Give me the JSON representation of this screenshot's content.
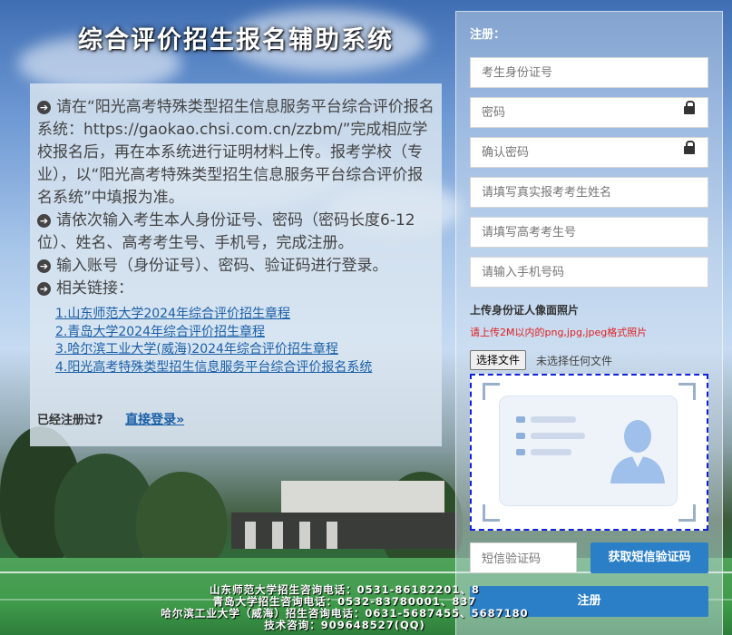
{
  "site": {
    "title": "综合评价招生报名辅助系统"
  },
  "info": {
    "items": [
      "请在“阳光高考特殊类型招生信息服务平台综合评价报名系统：https://gaokao.chsi.com.cn/zzbm/”完成相应学校报名后，再在本系统进行证明材料上传。报考学校（专业），以“阳光高考特殊类型招生信息服务平台综合评价报名系统”中填报为准。",
      "请依次输入考生本人身份证号、密码（密码长度6-12位）、姓名、高考考生号、手机号，完成注册。",
      "输入账号（身份证号）、密码、验证码进行登录。",
      "相关链接："
    ],
    "links": [
      "1.山东师范大学2024年综合评价招生章程",
      "2.青岛大学2024年综合评价招生章程",
      "3.哈尔滨工业大学(威海)2024年综合评价招生章程",
      "4.阳光高考特殊类型招生信息服务平台综合评价报名系统"
    ],
    "registered_prompt": "已经注册过?",
    "login_link": "直接登录»"
  },
  "register": {
    "heading": "注册：",
    "id_placeholder": "考生身份证号",
    "password_placeholder": "密码",
    "confirm_placeholder": "确认密码",
    "name_placeholder": "请填写真实报考考生姓名",
    "exam_no_placeholder": "请填写高考考生号",
    "phone_placeholder": "请输入手机号码",
    "upload_title": "上传身份证人像面照片",
    "upload_hint": "请上传2M以内的png,jpg,jpeg格式照片",
    "file_button": "选择文件",
    "file_status": "未选择任何文件",
    "sms_placeholder": "短信验证码",
    "sms_button": "获取短信验证码",
    "submit_button": "注册"
  },
  "footer": {
    "lines": [
      "山东师范大学招生咨询电话：0531-86182201、8",
      "青岛大学招生咨询电话：0532-83780001、837",
      "哈尔滨工业大学（威海）招生咨询电话：0631-5687455、5687180",
      "技术咨询：909648527(QQ)"
    ]
  },
  "colors": {
    "accent": "#2b7fc7",
    "link": "#1a5fa8",
    "hint": "#e02020",
    "preview_border": "#1020e0"
  }
}
